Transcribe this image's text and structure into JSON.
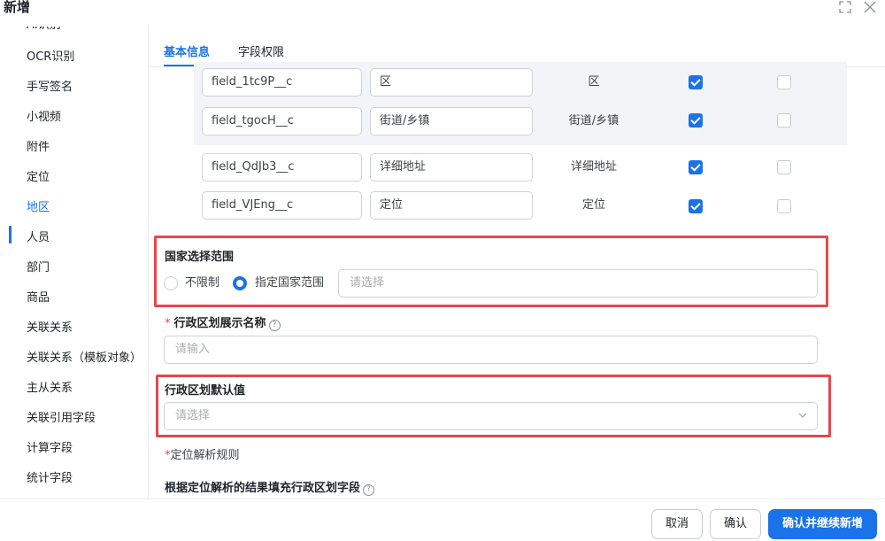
{
  "dialog": {
    "title": "新增",
    "expand_icon": "expand-icon",
    "close_icon": "close-icon"
  },
  "sidebar": {
    "items": [
      {
        "label": "AI识别"
      },
      {
        "label": "OCR识别"
      },
      {
        "label": "手写签名"
      },
      {
        "label": "小视频"
      },
      {
        "label": "附件"
      },
      {
        "label": "定位"
      },
      {
        "label": "地区",
        "active": true
      },
      {
        "label": "人员"
      },
      {
        "label": "部门"
      },
      {
        "label": "商品"
      },
      {
        "label": "关联关系"
      },
      {
        "label": "关联关系（模板对象）"
      },
      {
        "label": "主从关系"
      },
      {
        "label": "关联引用字段"
      },
      {
        "label": "计算字段"
      },
      {
        "label": "统计字段"
      }
    ]
  },
  "tabs": [
    {
      "label": "基本信息",
      "active": true
    },
    {
      "label": "字段权限"
    }
  ],
  "fields": [
    {
      "api_name": "field_1tc9P__c",
      "display": "区",
      "label": "区",
      "col1_checked": true,
      "col2_checked": false
    },
    {
      "api_name": "field_tgocH__c",
      "display": "街道/乡镇",
      "label": "街道/乡镇",
      "col1_checked": true,
      "col2_checked": false
    },
    {
      "api_name": "field_QdJb3__c",
      "display": "详细地址",
      "label": "详细地址",
      "col1_checked": true,
      "col2_checked": false
    },
    {
      "api_name": "field_VJEng__c",
      "display": "定位",
      "label": "定位",
      "col1_checked": true,
      "col2_checked": false
    }
  ],
  "country_range": {
    "label": "国家选择范围",
    "options": [
      {
        "label": "不限制",
        "selected": false
      },
      {
        "label": "指定国家范围",
        "selected": true
      }
    ],
    "select_placeholder": "请选择"
  },
  "display_name": {
    "required_mark": "*",
    "label": "行政区划展示名称",
    "help": "?",
    "placeholder": "请输入"
  },
  "default_value": {
    "label": "行政区划默认值",
    "placeholder": "请选择"
  },
  "locate_rule": {
    "required_mark": "*",
    "label": "定位解析规则"
  },
  "fill_rule": {
    "label": "根据定位解析的结果填充行政区划字段",
    "help": "?"
  },
  "footer": {
    "cancel": "取消",
    "confirm": "确认",
    "confirm_continue": "确认并继续新增"
  },
  "colors": {
    "accent": "#1a73e8",
    "highlight": "#e5484d"
  }
}
